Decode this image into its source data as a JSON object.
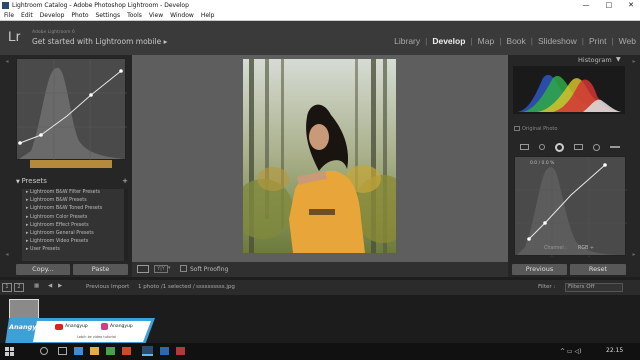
{
  "window": {
    "title": "Lightroom Catalog - Adobe Photoshop Lightroom - Develop",
    "controls": [
      "—",
      "□",
      "✕"
    ]
  },
  "menu": [
    "File",
    "Edit",
    "Develop",
    "Photo",
    "Settings",
    "Tools",
    "View",
    "Window",
    "Help"
  ],
  "identity": {
    "logo": "Lr",
    "version": "Adobe Lightroom 6",
    "mobile": "Get started with Lightroom mobile ▸"
  },
  "modules": [
    "Library",
    "Develop",
    "Map",
    "Book",
    "Slideshow",
    "Print",
    "Web"
  ],
  "active_module": "Develop",
  "left": {
    "presets_title": "Presets",
    "presets": [
      "Lightroom B&W Filter Presets",
      "Lightroom B&W Presets",
      "Lightroom B&W Toned Presets",
      "Lightroom Color Presets",
      "Lightroom Effect Presets",
      "Lightroom General Presets",
      "Lightroom Video Presets",
      "User Presets"
    ],
    "copy_label": "Copy...",
    "paste_label": "Paste"
  },
  "toolbar": {
    "soft_proofing": "Soft Proofing"
  },
  "right": {
    "histogram_title": "Histogram",
    "original_photo": "Original Photo",
    "curve_readout": "0.0 / 0.0 %",
    "channel_label": "Channel :",
    "channel_value": "RGB ÷",
    "previous_label": "Previous",
    "reset_label": "Reset"
  },
  "filmbar": {
    "page1": "1",
    "page2": "2",
    "previous_import": "Previous Import",
    "photo_info": "1 photo /1 selected /",
    "filename": "ssssssssss.jpg",
    "filter_label": "Filter :",
    "filter_value": "Filters Off"
  },
  "watermark": {
    "name": "Anangyup",
    "social1": "Anangyup",
    "social2": "Anangyup",
    "tagline": "Lebih ke video tutorial"
  },
  "taskbar": {
    "time": "22.15"
  }
}
